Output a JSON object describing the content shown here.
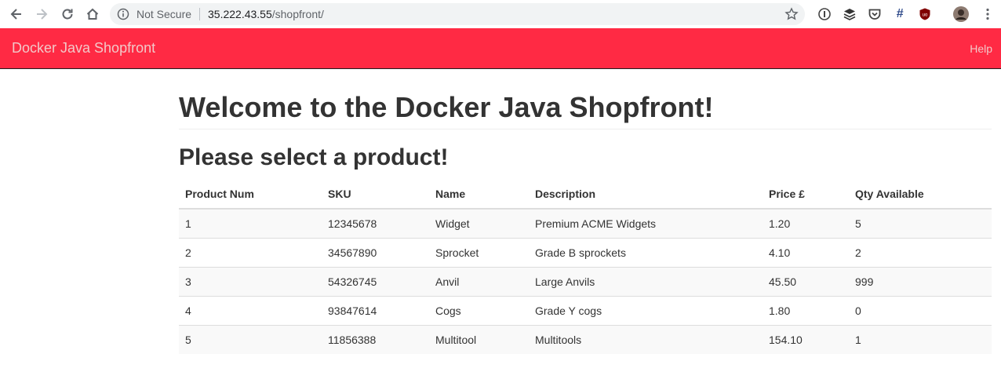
{
  "browser": {
    "security_label": "Not Secure",
    "url_host": "35.222.43.55",
    "url_path": "/shopfront/",
    "icons": [
      "back-icon",
      "forward-icon",
      "reload-icon",
      "home-icon",
      "info-icon",
      "star-icon",
      "extension-icon",
      "layers-icon",
      "pocket-icon",
      "hashtag-icon",
      "ublock-icon",
      "profile-avatar",
      "menu-icon"
    ]
  },
  "navbar": {
    "brand": "Docker Java Shopfront",
    "help": "Help",
    "color": "#ff2a44"
  },
  "main": {
    "welcome": "Welcome to the Docker Java Shopfront!",
    "subtitle": "Please select a product!"
  },
  "table": {
    "headers": [
      "Product Num",
      "SKU",
      "Name",
      "Description",
      "Price £",
      "Qty Available"
    ],
    "rows": [
      [
        "1",
        "12345678",
        "Widget",
        "Premium ACME Widgets",
        "1.20",
        "5"
      ],
      [
        "2",
        "34567890",
        "Sprocket",
        "Grade B sprockets",
        "4.10",
        "2"
      ],
      [
        "3",
        "54326745",
        "Anvil",
        "Large Anvils",
        "45.50",
        "999"
      ],
      [
        "4",
        "93847614",
        "Cogs",
        "Grade Y cogs",
        "1.80",
        "0"
      ],
      [
        "5",
        "11856388",
        "Multitool",
        "Multitools",
        "154.10",
        "1"
      ]
    ]
  }
}
